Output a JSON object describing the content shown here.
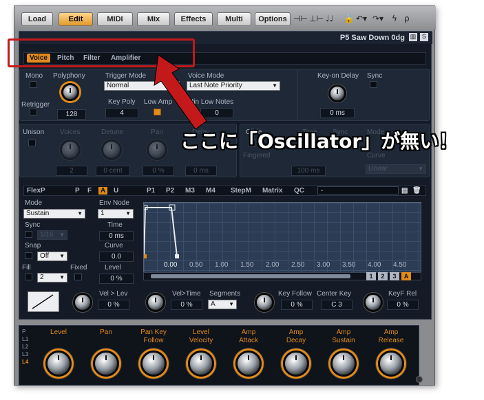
{
  "toolbar": {
    "buttons": [
      "Load",
      "Edit",
      "MIDI",
      "Mix",
      "Effects",
      "Multi",
      "Options"
    ],
    "active": "Edit"
  },
  "preset_name": "P5 Saw Down 0dg",
  "tabs": [
    "Voice",
    "Pitch",
    "Filter",
    "Amplifier"
  ],
  "voice": {
    "mono": "Mono",
    "polyphony": "Polyphony",
    "trigger_mode": "Trigger Mode",
    "trigger_mode_value": "Normal",
    "voice_mode": "Voice Mode",
    "voice_mode_value": "Last Note Priority",
    "retrigger": "Retrigger",
    "polyphony_value": "128",
    "key_poly": "Key Poly",
    "key_poly_value": "4",
    "low_amp": "Low Amp",
    "min_low_notes": "Min Low Notes",
    "min_low_notes_value": "0",
    "key_on_delay": "Key-on Delay",
    "sync": "Sync",
    "key_on_delay_value": "0 ms"
  },
  "unison": {
    "label": "Unison",
    "voices": "Voices",
    "detune": "Detune",
    "pan": "Pan",
    "delay": "Delay",
    "voices_value": "2",
    "detune_value": "0 cent",
    "pan_value": "0 %",
    "delay_value": "0 ms"
  },
  "glide": {
    "label": "Glide",
    "time": "Time",
    "sync": "Sync",
    "mode": "Mode",
    "fingered": "Fingered",
    "curve": "Curve",
    "time_value": "100 ms",
    "curve_value": "Linear"
  },
  "env_tabs": [
    "FlexP",
    "P",
    "F",
    "A",
    "U",
    "P1",
    "P2",
    "M3",
    "M4",
    "StepM",
    "Matrix",
    "QC"
  ],
  "env_preset": "-",
  "env": {
    "mode": "Mode",
    "mode_value": "Sustain",
    "env_node": "Env Node",
    "env_node_value": "1",
    "sync": "Sync",
    "sync_value": "1/16",
    "time": "Time",
    "time_value": "0 ms",
    "snap": "Snap",
    "snap_value": "Off",
    "curve": "Curve",
    "curve_value": "0.0",
    "fill": "Fill",
    "fixed": "Fixed",
    "fill_value": "2",
    "level": "Level",
    "level_value": "0 %",
    "axis_ticks": [
      "0.00",
      "0.50",
      "1.00",
      "1.50",
      "2.00",
      "2.50",
      "3.00",
      "3.50",
      "4.00",
      "4.50"
    ],
    "pages": [
      "1",
      "2",
      "3",
      "A"
    ]
  },
  "mods": {
    "vel_lev": "Vel > Lev",
    "vel_lev_value": "0 %",
    "vel_time": "Vel>Time",
    "vel_time_value": "0 %",
    "segments": "Segments",
    "segments_value": "A",
    "key_follow": "Key Follow",
    "key_follow_value": "0 %",
    "center_key": "Center Key",
    "center_key_value": "C 3",
    "keyf_rel": "KeyF Rel",
    "keyf_rel_value": "0 %"
  },
  "quick": {
    "layers": [
      "P",
      "L1",
      "L2",
      "L3",
      "L4"
    ],
    "knobs": [
      {
        "top": "Level",
        "bottom": ""
      },
      {
        "top": "Pan",
        "bottom": ""
      },
      {
        "top": "Pan Key",
        "bottom": "Follow"
      },
      {
        "top": "Level",
        "bottom": "Velocity"
      },
      {
        "top": "Amp",
        "bottom": "Attack"
      },
      {
        "top": "Amp",
        "bottom": "Decay"
      },
      {
        "top": "Amp",
        "bottom": "Sustain"
      },
      {
        "top": "Amp",
        "bottom": "Release"
      }
    ]
  },
  "annotation": "ここに「Oscillator」が無い！",
  "colors": {
    "accent": "#e28a1b",
    "annotation": "#c4191b",
    "screen": "#141b26"
  }
}
